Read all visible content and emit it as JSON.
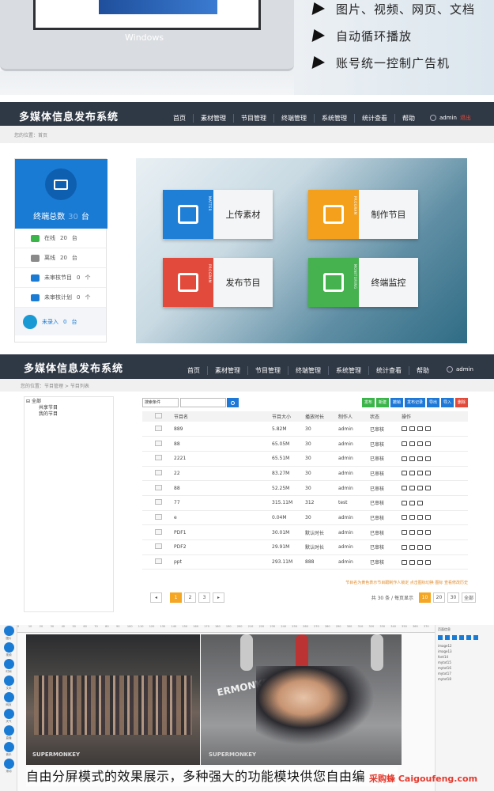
{
  "banner": {
    "laptop_label": "Windows",
    "bullets": [
      "图片、视频、网页、文档",
      "自动循环播放",
      "账号统一控制广告机"
    ]
  },
  "nav1": {
    "logo": "多媒体信息发布系统",
    "menu": [
      "首页",
      "素材管理",
      "节目管理",
      "终端管理",
      "系统管理",
      "统计查看",
      "帮助"
    ],
    "user": "admin",
    "logout": "退出",
    "breadcrumb": "您的位置：首页"
  },
  "stats": {
    "total_label": "终端总数",
    "total_value": "30",
    "total_unit": "台",
    "rows": [
      {
        "label": "在线",
        "value": "20",
        "unit": "台",
        "color": "#3bb54a"
      },
      {
        "label": "离线",
        "value": "20",
        "unit": "台",
        "color": "#8a8a8a"
      },
      {
        "label": "未审核节目",
        "value": "0",
        "unit": "个",
        "color": "#1a7bd4"
      },
      {
        "label": "未审核计划",
        "value": "0",
        "unit": "个",
        "color": "#1a7bd4"
      }
    ],
    "footer_label": "未录入",
    "footer_value": "0",
    "footer_unit": "台"
  },
  "tiles": [
    {
      "label": "上传素材",
      "sub": "MATTER",
      "color": "#1f7fd6"
    },
    {
      "label": "制作节目",
      "sub": "PROGRAM",
      "color": "#f4a01c"
    },
    {
      "label": "发布节目",
      "sub": "PROGRAM",
      "color": "#e24a3b"
    },
    {
      "label": "终端监控",
      "sub": "MONITORING",
      "color": "#45b14f"
    }
  ],
  "nav2": {
    "logo": "多媒体信息发布系统",
    "menu": [
      "首页",
      "素材管理",
      "节目管理",
      "终端管理",
      "系统管理",
      "统计查看",
      "帮助"
    ],
    "user": "admin",
    "breadcrumb": "您的位置：节目管理 > 节目列表"
  },
  "tree": [
    "全部",
    "共享节目",
    "我的节目"
  ],
  "toolbar": {
    "select": "搜索条件",
    "buttons": [
      {
        "label": "发布",
        "color": "#3bb54a"
      },
      {
        "label": "新建",
        "color": "#3bb54a"
      },
      {
        "label": "撤销",
        "color": "#1e78d7"
      },
      {
        "label": "发布记录",
        "color": "#1e78d7"
      },
      {
        "label": "导出",
        "color": "#1e78d7"
      },
      {
        "label": "导入",
        "color": "#1e78d7"
      },
      {
        "label": "删除",
        "color": "#e24a3b"
      }
    ]
  },
  "table": {
    "headers": [
      "节目名",
      "节目大小",
      "播放时长",
      "制作人",
      "状态",
      "操作"
    ],
    "rows": [
      [
        "889",
        "5.82M",
        "30",
        "admin",
        "已审核"
      ],
      [
        "88",
        "65.05M",
        "30",
        "admin",
        "已审核"
      ],
      [
        "2221",
        "65.51M",
        "30",
        "admin",
        "已审核"
      ],
      [
        "22",
        "83.27M",
        "30",
        "admin",
        "已审核"
      ],
      [
        "88",
        "52.25M",
        "30",
        "admin",
        "已审核"
      ],
      [
        "77",
        "315.11M",
        "312",
        "test",
        "已审核"
      ],
      [
        "e",
        "0.04M",
        "30",
        "admin",
        "已审核"
      ],
      [
        "PDF1",
        "30.01M",
        "默认时长",
        "admin",
        "已审核"
      ],
      [
        "PDF2",
        "29.91M",
        "默认时长",
        "admin",
        "已审核"
      ],
      [
        "ppt",
        "293.11M",
        "888",
        "admin",
        "已审核"
      ]
    ]
  },
  "note": "节目名为黄色表示节目跟制作人锁定 点击图标切换 图标 查看修改历史",
  "pager": {
    "prev": "◂",
    "pages": [
      "1",
      "2",
      "3"
    ],
    "next": "▸",
    "summary": "共 30 条 / 每页显示",
    "sizes": [
      "10",
      "20",
      "30",
      "全部"
    ]
  },
  "editor": {
    "tools": [
      "图片",
      "视频",
      "时间",
      "文本",
      "网页",
      "天气",
      "直播",
      "音乐",
      "滚动"
    ],
    "ruler": [
      "0",
      "10",
      "20",
      "30",
      "40",
      "50",
      "60",
      "70",
      "80",
      "90",
      "100",
      "110",
      "120",
      "130",
      "140",
      "150",
      "160",
      "170",
      "180",
      "190",
      "200",
      "210",
      "220",
      "230",
      "240",
      "250",
      "260",
      "270",
      "280",
      "290",
      "300",
      "310",
      "320",
      "330",
      "340",
      "350",
      "360",
      "370"
    ],
    "panel_title": "页面信息",
    "panel_files": [
      "image12",
      "image13",
      "font14",
      "mytxt15",
      "mytxt16",
      "mytxt17",
      "mytxt18"
    ],
    "brand_left": "SUPERMONKEY",
    "brand_right": "SUPERMONKEY",
    "wall_text": "ERMONKE",
    "caption": "自由分屏模式的效果展示，多种强大的功能模块供您自由编"
  },
  "watermark": "采购蜂 Caigoufeng.com"
}
